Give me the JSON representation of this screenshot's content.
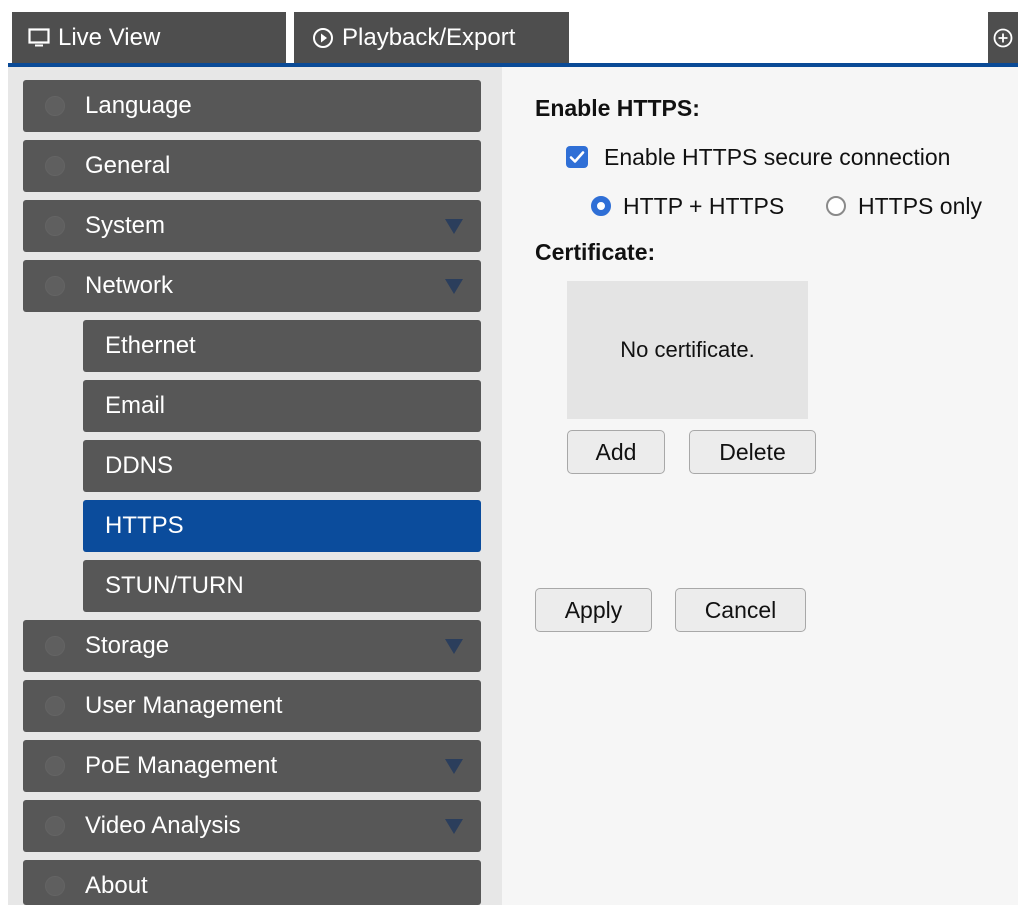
{
  "tabs": {
    "live_view": "Live View",
    "playback_export": "Playback/Export"
  },
  "sidebar": {
    "items": [
      {
        "label": "Language"
      },
      {
        "label": "General"
      },
      {
        "label": "System"
      },
      {
        "label": "Network"
      },
      {
        "label": "Storage"
      },
      {
        "label": "User Management"
      },
      {
        "label": "PoE Management"
      },
      {
        "label": "Video Analysis"
      },
      {
        "label": "About"
      }
    ],
    "network_sub": [
      {
        "label": "Ethernet"
      },
      {
        "label": "Email"
      },
      {
        "label": "DDNS"
      },
      {
        "label": "HTTPS",
        "active": true
      },
      {
        "label": "STUN/TURN"
      }
    ]
  },
  "https": {
    "enable_heading": "Enable HTTPS:",
    "enable_checkbox_label": "Enable HTTPS secure connection",
    "enable_checked": true,
    "mode_options": [
      "HTTP + HTTPS",
      "HTTPS only"
    ],
    "mode_selected": "HTTP + HTTPS",
    "certificate_heading": "Certificate:",
    "certificate_status": "No certificate.",
    "add_label": "Add",
    "delete_label": "Delete",
    "apply_label": "Apply",
    "cancel_label": "Cancel"
  },
  "colors": {
    "accent": "#0b4c9c",
    "nav_bg": "#575757",
    "checkbox": "#2f6fd6"
  }
}
